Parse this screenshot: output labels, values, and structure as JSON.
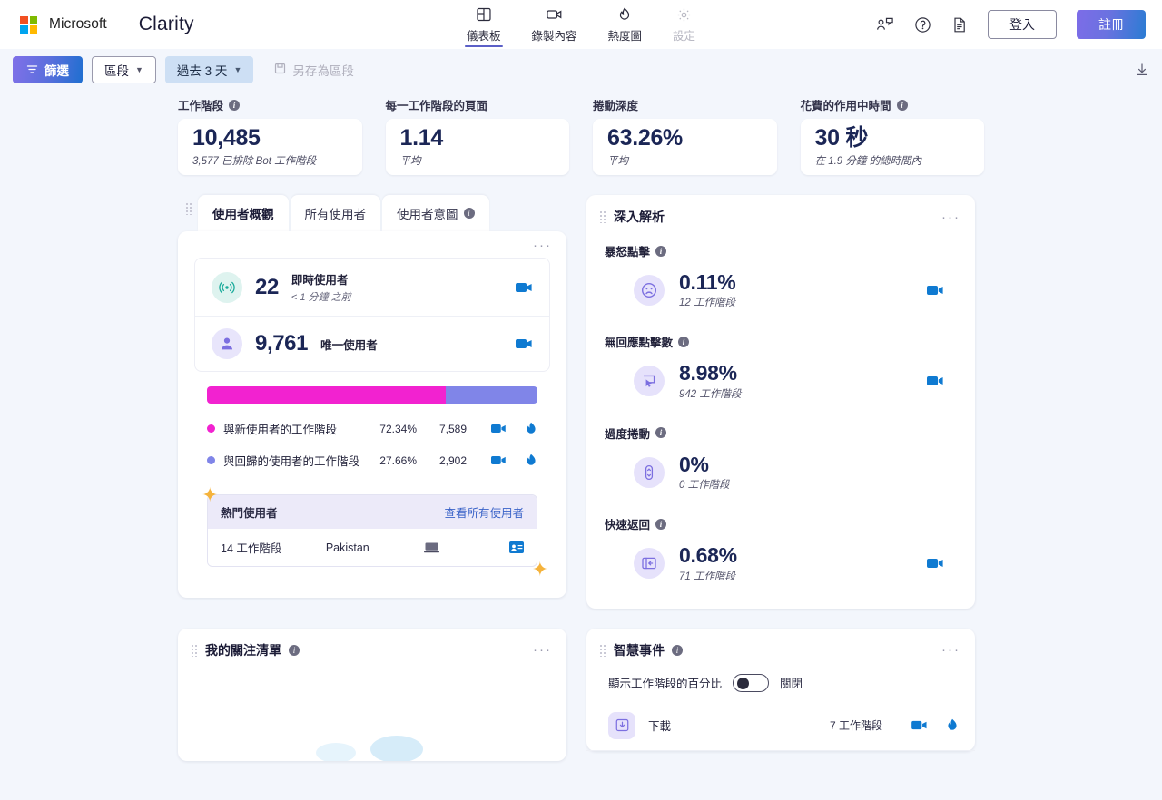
{
  "header": {
    "brand_microsoft": "Microsoft",
    "brand_product": "Clarity",
    "nav": [
      {
        "label": "儀表板",
        "icon": "dashboard-icon",
        "active": true
      },
      {
        "label": "錄製內容",
        "icon": "video-icon",
        "active": false
      },
      {
        "label": "熱度圖",
        "icon": "flame-icon",
        "active": false
      },
      {
        "label": "設定",
        "icon": "gear-icon",
        "active": false,
        "disabled": true
      }
    ],
    "icons": [
      {
        "name": "feedback-icon"
      },
      {
        "name": "help-icon"
      },
      {
        "name": "docs-icon"
      }
    ],
    "signin_label": "登入",
    "signup_label": "註冊",
    "accent_gradient_start": "#7d6ce8",
    "accent_gradient_end": "#2b7cd3"
  },
  "toolbar": {
    "filter_label": "篩選",
    "segment_label": "區段",
    "date_label": "過去 3 天",
    "save_segment_label": "另存為區段",
    "download_icon": "download-icon"
  },
  "kpis": [
    {
      "label": "工作階段",
      "has_info": true,
      "value": "10,485",
      "sub": "3,577 已排除 Bot 工作階段"
    },
    {
      "label": "每一工作階段的頁面",
      "has_info": false,
      "value": "1.14",
      "sub": "平均"
    },
    {
      "label": "捲動深度",
      "has_info": false,
      "value": "63.26%",
      "sub": "平均"
    },
    {
      "label": "花費的作用中時間",
      "has_info": true,
      "value": "30 秒",
      "sub": "在 1.9 分鐘 的總時間內"
    }
  ],
  "user_overview": {
    "tabs": [
      {
        "label": "使用者概觀",
        "active": true,
        "has_info": false
      },
      {
        "label": "所有使用者",
        "active": false,
        "has_info": false
      },
      {
        "label": "使用者意圖",
        "active": false,
        "has_info": true
      }
    ],
    "kebab": "···",
    "live": {
      "value": "22",
      "title": "即時使用者",
      "sub": "< 1 分鐘 之前",
      "icon": "live-signal-icon"
    },
    "unique": {
      "value": "9,761",
      "title": "唯一使用者",
      "icon": "person-icon"
    },
    "split": {
      "new_pct_width": "72.34%",
      "returning_pct_width": "27.66%",
      "new_color": "#f222d0",
      "returning_color": "#8085e8"
    },
    "legend": [
      {
        "label": "與新使用者的工作階段",
        "pct": "72.34%",
        "count": "7,589",
        "color": "#f222d0"
      },
      {
        "label": "與回歸的使用者的工作階段",
        "pct": "27.66%",
        "count": "2,902",
        "color": "#8085e8"
      }
    ],
    "top_users": {
      "title": "熱門使用者",
      "link": "查看所有使用者",
      "rows": [
        {
          "sessions": "14 工作階段",
          "country": "Pakistan",
          "device": "desktop-icon",
          "card": "user-card-icon"
        }
      ]
    }
  },
  "insights": {
    "title": "深入解析",
    "kebab": "···",
    "items": [
      {
        "label": "暴怒點擊",
        "value": "0.11%",
        "sub": "12 工作階段",
        "icon": "sad-face-icon",
        "has_video": true
      },
      {
        "label": "無回應點擊數",
        "value": "8.98%",
        "sub": "942 工作階段",
        "icon": "dead-click-icon",
        "has_video": true
      },
      {
        "label": "過度捲動",
        "value": "0%",
        "sub": "0 工作階段",
        "icon": "scroll-icon",
        "has_video": false
      },
      {
        "label": "快速返回",
        "value": "0.68%",
        "sub": "71 工作階段",
        "icon": "quick-back-icon",
        "has_video": true
      }
    ]
  },
  "watchlist": {
    "title": "我的關注清單",
    "kebab": "···",
    "has_info": true
  },
  "smart_events": {
    "title": "智慧事件",
    "kebab": "···",
    "has_info": true,
    "toggle_label": "顯示工作階段的百分比",
    "toggle_state": "關閉",
    "rows": [
      {
        "name": "下載",
        "count": "7 工作階段",
        "icon": "download-event-icon"
      }
    ]
  }
}
